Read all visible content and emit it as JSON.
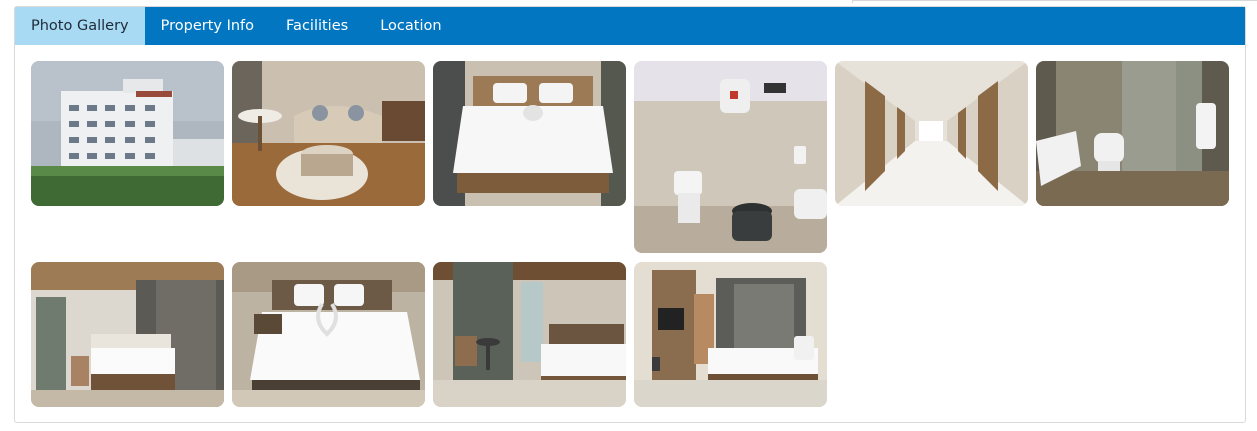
{
  "tabs": [
    {
      "label": "Photo Gallery",
      "active": true
    },
    {
      "label": "Property Info",
      "active": false
    },
    {
      "label": "Facilities",
      "active": false
    },
    {
      "label": "Location",
      "active": false
    }
  ],
  "colors": {
    "tab_bar": "#0276c1",
    "active_tab": "#a9daf3",
    "panel_border": "#d9d9d9"
  },
  "gallery": {
    "photos": [
      {
        "subject": "hotel-exterior"
      },
      {
        "subject": "lounge-seating"
      },
      {
        "subject": "bedroom"
      },
      {
        "subject": "bathroom-geyser"
      },
      {
        "subject": "corridor"
      },
      {
        "subject": "bathroom-shower"
      },
      {
        "subject": "bedroom-window"
      },
      {
        "subject": "bedroom-towel-swans"
      },
      {
        "subject": "bedroom-sitting-area"
      },
      {
        "subject": "bedroom-tv"
      }
    ]
  }
}
